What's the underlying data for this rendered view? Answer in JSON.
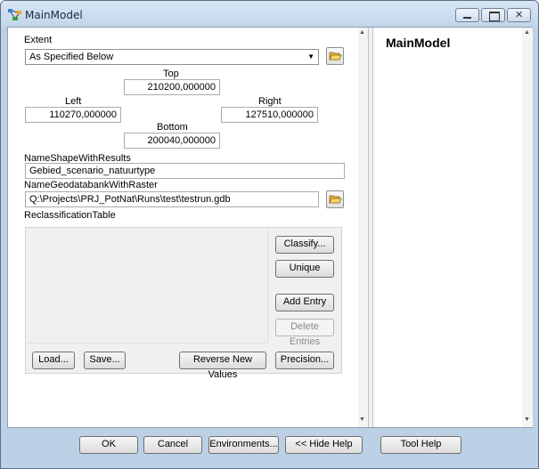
{
  "window": {
    "title": "MainModel"
  },
  "params": {
    "extent_label": "Extent",
    "extent_value": "As Specified Below",
    "top_label": "Top",
    "top_value": "210200,000000",
    "left_label": "Left",
    "left_value": "110270,000000",
    "right_label": "Right",
    "right_value": "127510,000000",
    "bottom_label": "Bottom",
    "bottom_value": "200040,000000",
    "shape_label": "NameShapeWithResults",
    "shape_value": "Gebied_scenario_natuurtype",
    "gdb_label": "NameGeodatabankWithRaster",
    "gdb_value": "Q:\\Projects\\PRJ_PotNat\\Runs\\test\\testrun.gdb",
    "reclass_label": "ReclassificationTable"
  },
  "reclass_buttons": {
    "classify": "Classify...",
    "unique": "Unique",
    "add_entry": "Add Entry",
    "delete_entries": "Delete Entries",
    "load": "Load...",
    "save": "Save...",
    "reverse": "Reverse New Values",
    "precision": "Precision..."
  },
  "help": {
    "title": "MainModel"
  },
  "footer": {
    "ok": "OK",
    "cancel": "Cancel",
    "environments": "Environments...",
    "hide_help": "<< Hide Help",
    "tool_help": "Tool Help"
  },
  "colors": {
    "titlebar": "#c2d5ea",
    "frame": "#bcd0e6",
    "panel": "#f0f0f0"
  }
}
